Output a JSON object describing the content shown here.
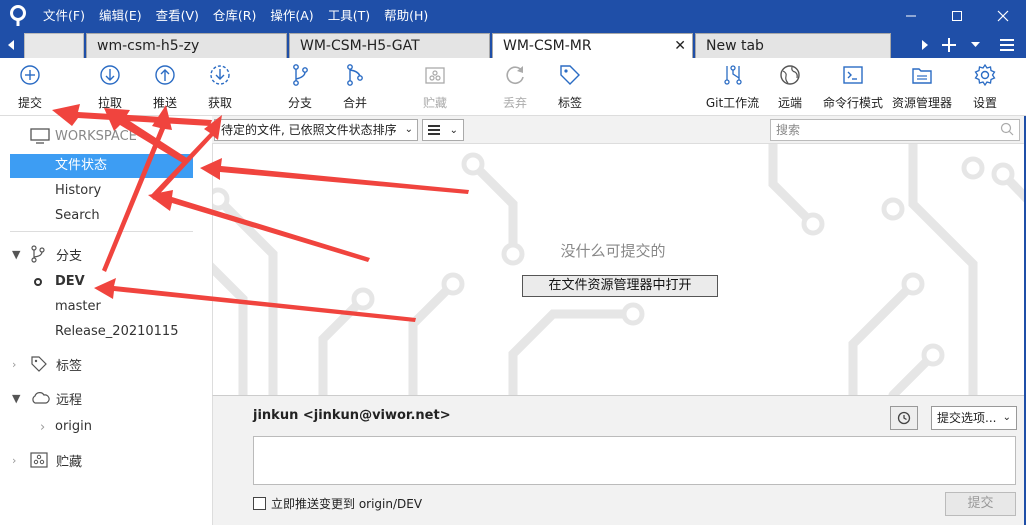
{
  "menu": [
    "文件(F)",
    "编辑(E)",
    "查看(V)",
    "仓库(R)",
    "操作(A)",
    "工具(T)",
    "帮助(H)"
  ],
  "tabs": [
    {
      "label": "wm-csm-h5-zy"
    },
    {
      "label": "WM-CSM-H5-GAT"
    },
    {
      "label": "WM-CSM-MR"
    },
    {
      "label": "New tab"
    }
  ],
  "toolbar": {
    "commit": "提交",
    "pull": "拉取",
    "push": "推送",
    "fetch": "获取",
    "branch": "分支",
    "merge": "合并",
    "stash": "贮藏",
    "discard": "丢弃",
    "tag": "标签",
    "gitflow": "Git工作流",
    "remote": "远端",
    "terminal": "命令行模式",
    "explorer": "资源管理器",
    "settings": "设置"
  },
  "sidebar": {
    "workspace_label": "WORKSPACE",
    "workspace_items": [
      "文件状态",
      "History",
      "Search"
    ],
    "branches_label": "分支",
    "branches": [
      "DEV",
      "master",
      "Release_20210115"
    ],
    "tags_label": "标签",
    "remotes_label": "远程",
    "remotes": [
      "origin"
    ],
    "stashes_label": "贮藏"
  },
  "filter": {
    "sort_label": "待定的文件, 已依照文件状态排序",
    "search_placeholder": "搜索"
  },
  "main": {
    "empty_text": "没什么可提交的",
    "open_explorer": "在文件资源管理器中打开"
  },
  "commit": {
    "author": "jinkun <jinkun@viwor.net>",
    "options": "提交选项...",
    "push_check": "立即推送变更到 origin/DEV",
    "button": "提交"
  },
  "colors": {
    "titlebar": "#1f4fa8",
    "selection": "#3d9df3",
    "annotation_arrow": "#f0443e"
  }
}
